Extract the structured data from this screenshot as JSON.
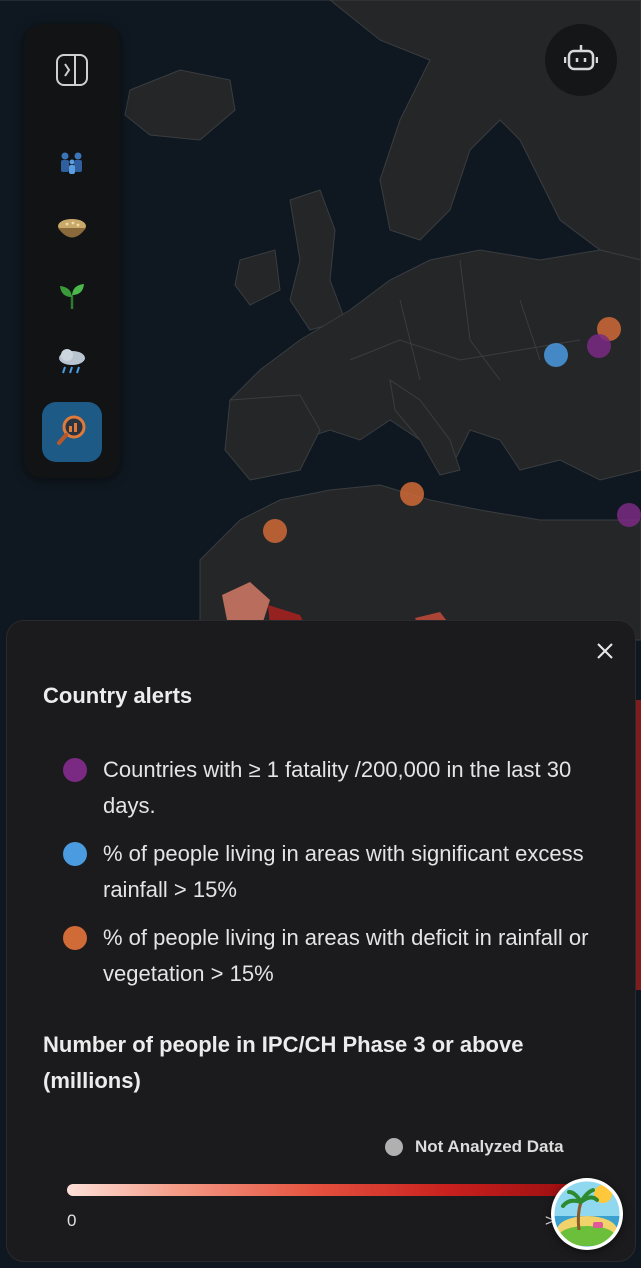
{
  "sidebar": {
    "items": [
      {
        "name": "toggle-panel",
        "icon": "sidebar-expand-icon"
      },
      {
        "name": "population",
        "icon": "people-icon"
      },
      {
        "name": "food",
        "icon": "food-bowl-icon"
      },
      {
        "name": "vegetation",
        "icon": "seedling-icon"
      },
      {
        "name": "rainfall",
        "icon": "rain-cloud-icon"
      },
      {
        "name": "alerts",
        "icon": "magnifier-chart-icon",
        "active": true
      }
    ]
  },
  "chatbot": {
    "icon": "robot-icon"
  },
  "legend": {
    "title": "Country alerts",
    "items": [
      {
        "color": "#7a2a82",
        "text": "Countries with ≥ 1 fatality /200,000 in the last 30 days."
      },
      {
        "color": "#4a9be0",
        "text": "% of people living in areas with significant excess rainfall > 15%"
      },
      {
        "color": "#d06a36",
        "text": "% of people living in areas with deficit in rainfall or vegetation > 15%"
      }
    ],
    "ipc_title": "Number of people in IPC/CH Phase 3 or above (millions)",
    "not_analyzed": "Not Analyzed Data",
    "scale_min": "0",
    "scale_max": ">"
  },
  "colors": {
    "purple": "#7a2a82",
    "blue": "#4a9be0",
    "orange": "#d06a36",
    "active_sidebar": "#1e5a86"
  }
}
